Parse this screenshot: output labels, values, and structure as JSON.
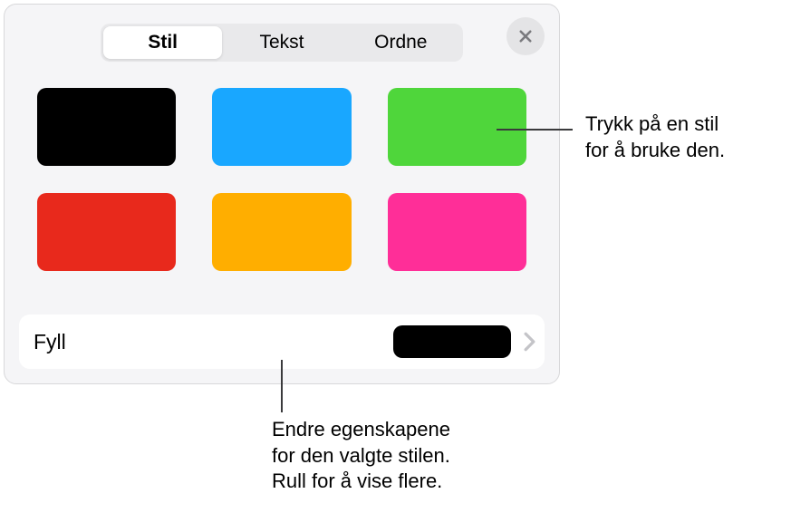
{
  "tabs": {
    "style": "Stil",
    "text": "Tekst",
    "arrange": "Ordne"
  },
  "swatches": {
    "colors": [
      "#000000",
      "#19a7ff",
      "#4fd63b",
      "#e8291c",
      "#ffae00",
      "#ff2e98"
    ]
  },
  "fillRow": {
    "label": "Fyll",
    "chipColor": "#000000"
  },
  "callouts": {
    "topLine1": "Trykk på en stil",
    "topLine2": "for å bruke den.",
    "bottomLine1": "Endre egenskapene",
    "bottomLine2": "for den valgte stilen.",
    "bottomLine3": "Rull for å vise flere."
  }
}
